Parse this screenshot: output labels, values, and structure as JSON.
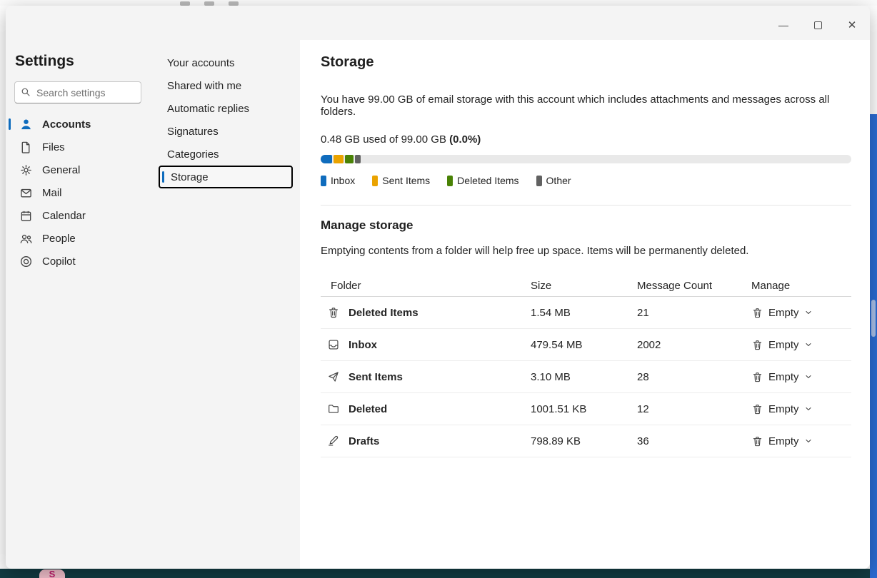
{
  "window": {
    "controls": {
      "minimize_glyph": "—",
      "close_glyph": "✕"
    }
  },
  "background": {
    "badge_letter": "S"
  },
  "icons": {
    "search": "magnifier",
    "minimize": "horizontal-line",
    "maximize": "square-outline",
    "close": "x-cross",
    "chevron_down": "chevron",
    "trash": "trash-can",
    "accounts": "person",
    "files": "document",
    "general": "gear",
    "mail": "envelope",
    "calendar": "calendar-grid",
    "people": "two-people",
    "copilot": "copilot-ring",
    "inbox": "mail-tray",
    "sent": "paper-plane",
    "deleted": "folder",
    "drafts": "pencil"
  },
  "settings": {
    "title": "Settings",
    "search_placeholder": "Search settings",
    "nav": [
      {
        "label": "Accounts",
        "selected": true
      },
      {
        "label": "Files"
      },
      {
        "label": "General"
      },
      {
        "label": "Mail"
      },
      {
        "label": "Calendar"
      },
      {
        "label": "People"
      },
      {
        "label": "Copilot"
      }
    ],
    "subnav": [
      {
        "label": "Your accounts"
      },
      {
        "label": "Shared with me"
      },
      {
        "label": "Automatic replies"
      },
      {
        "label": "Signatures"
      },
      {
        "label": "Categories"
      },
      {
        "label": "Storage",
        "selected": true
      }
    ]
  },
  "storage": {
    "title": "Storage",
    "description": "You have 99.00 GB of email storage with this account which includes attachments and messages across all folders.",
    "usage_prefix": "0.48 GB used of 99.00 GB ",
    "usage_percent_bold": "(0.0%)",
    "bar": {
      "track_color": "#e9e9e9",
      "segments": [
        {
          "name": "Inbox",
          "color": "#0f6cbd",
          "width_pct": 2.2
        },
        {
          "name": "Sent Items",
          "color": "#eaa300",
          "width_pct": 1.8
        },
        {
          "name": "Deleted Items",
          "color": "#498205",
          "width_pct": 1.6
        },
        {
          "name": "Other",
          "color": "#616161",
          "width_pct": 1.2
        }
      ]
    },
    "legend": [
      {
        "label": "Inbox",
        "color": "#0f6cbd"
      },
      {
        "label": "Sent Items",
        "color": "#eaa300"
      },
      {
        "label": "Deleted Items",
        "color": "#498205"
      },
      {
        "label": "Other",
        "color": "#616161"
      }
    ],
    "manage": {
      "title": "Manage storage",
      "description": "Emptying contents from a folder will help free up space. Items will be permanently deleted.",
      "columns": [
        "Folder",
        "Size",
        "Message Count",
        "Manage"
      ],
      "empty_label": "Empty",
      "rows": [
        {
          "icon": "trash-icon",
          "folder": "Deleted Items",
          "size": "1.54 MB",
          "count": "21"
        },
        {
          "icon": "inbox-icon",
          "folder": "Inbox",
          "size": "479.54 MB",
          "count": "2002"
        },
        {
          "icon": "send-icon",
          "folder": "Sent Items",
          "size": "3.10 MB",
          "count": "28"
        },
        {
          "icon": "folder-icon",
          "folder": "Deleted",
          "size": "1001.51 KB",
          "count": "12"
        },
        {
          "icon": "drafts-icon",
          "folder": "Drafts",
          "size": "798.89 KB",
          "count": "36"
        }
      ]
    }
  }
}
